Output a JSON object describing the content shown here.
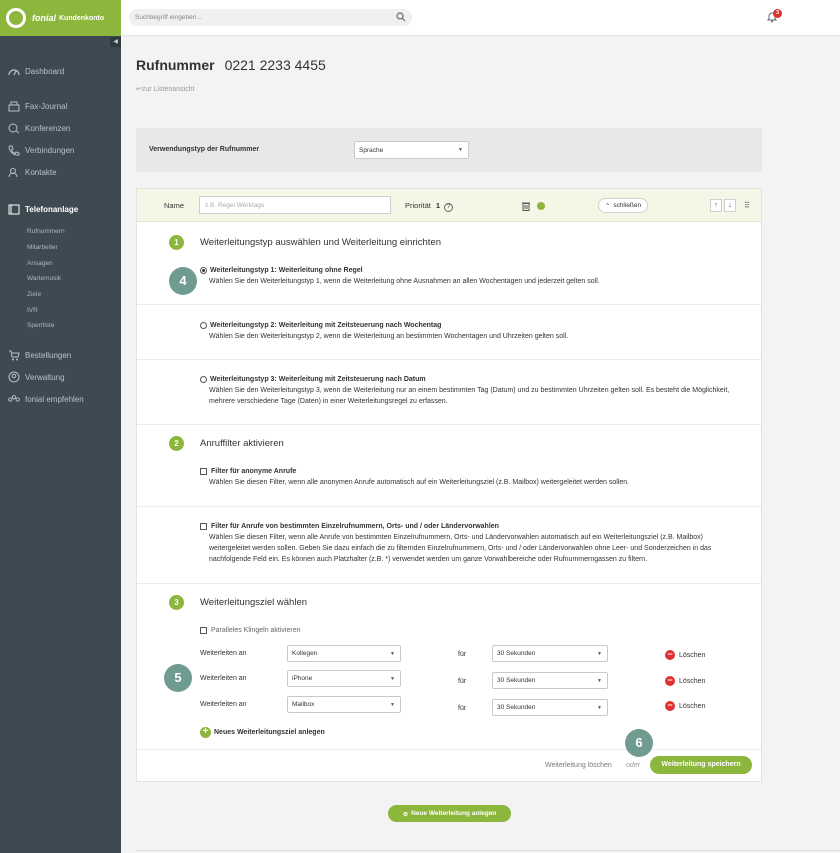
{
  "app": {
    "brand": "fonial",
    "brand_sub": "Kundenkonto"
  },
  "search": {
    "placeholder": "Suchbegriff eingeben..."
  },
  "notifications": {
    "count": "3"
  },
  "sidebar": {
    "items": [
      {
        "label": "Dashboard",
        "icon": "dashboard-icon"
      },
      {
        "label": "Fax-Journal",
        "icon": "fax-icon"
      },
      {
        "label": "Konferenzen",
        "icon": "conference-icon"
      },
      {
        "label": "Verbindungen",
        "icon": "phone-icon"
      },
      {
        "label": "Kontakte",
        "icon": "contacts-icon"
      },
      {
        "label": "Telefonanlage",
        "icon": "pbx-icon"
      }
    ],
    "sub_items": [
      "Rufnummern",
      "Mitarbeiter",
      "Ansagen",
      "Wartemusik",
      "Ziele",
      "IVR",
      "Sperrliste"
    ],
    "bottom_items": [
      {
        "label": "Bestellungen",
        "icon": "cart-icon"
      },
      {
        "label": "Verwaltung",
        "icon": "user-icon"
      },
      {
        "label": "fonial empfehlen",
        "icon": "recommend-icon"
      }
    ]
  },
  "page": {
    "title_label": "Rufnummer",
    "title_number": "0221 2233 4455",
    "back_link": "zur Listenansicht"
  },
  "usage": {
    "label": "Verwendungstyp der Rufnummer",
    "value": "Sprache"
  },
  "rule": {
    "name_label": "Name",
    "name_placeholder": "z.B. Regel Werktags",
    "priority_label": "Priorität",
    "priority_value": "1",
    "close_label": "schließen"
  },
  "step1": {
    "num": "1",
    "title": "Weiterleitungstyp auswählen und Weiterleitung einrichten",
    "options": [
      {
        "title": "Weiterleitungstyp 1: Weiterleitung ohne Regel",
        "desc": "Wählen Sie den Weiterleitungstyp 1, wenn die Weiterleitung ohne Ausnahmen an allen Wochentagen und jederzeit gelten soll.",
        "selected": true
      },
      {
        "title": "Weiterleitungstyp 2: Weiterleitung mit Zeitsteuerung nach Wochentag",
        "desc": "Wählen Sie den Weiterleitungstyp 2, wenn die Weiterleitung an bestimmten Wochentagen und Uhrzeiten gelten soll.",
        "selected": false
      },
      {
        "title": "Weiterleitungstyp 3: Weiterleitung mit Zeitsteuerung nach Datum",
        "desc": "Wählen Sie den Weiterleitungstyp 3, wenn die Weiterleitung nur an einem bestimmten Tag (Datum) und zu bestimmten Uhrzeiten gelten soll. Es besteht die Möglichkeit, mehrere verschiedene Tage (Daten) in einer Weiterleitungsregel zu erfassen.",
        "selected": false
      }
    ]
  },
  "step2": {
    "num": "2",
    "title": "Anruffilter aktivieren",
    "filters": [
      {
        "title": "Filter für anonyme Anrufe",
        "desc": "Wählen Sie diesen Filter, wenn alle anonymen Anrufe automatisch auf ein Weiterleitungsziel (z.B. Mailbox) weitergeleitet werden sollen."
      },
      {
        "title": "Filter für Anrufe von bestimmten Einzelrufnummern, Orts- und / oder Ländervorwahlen",
        "desc": "Wählen Sie diesen Filter, wenn alle Anrufe von bestimmten Einzelrufnummern, Orts- und Ländervorwahlen automatisch auf ein Weiterleitungsziel (z.B. Mailbox) weitergeleitet werden sollen. Geben Sie dazu einfach die zu filternden Einzelrufnummern, Orts- und / oder Ländervorwahlen ohne Leer- und Sonderzeichen in das nachfolgende Feld ein. Es können auch Platzhalter (z.B. *) verwendet werden um ganze Vorwahlbereiche oder Rufnummerngassen zu filtern."
      }
    ]
  },
  "step3": {
    "num": "3",
    "title": "Weiterleitungsziel wählen",
    "parallel_label": "Paralleles Klingeln aktivieren",
    "rows": [
      {
        "label": "Weiterleiten an",
        "target": "Kollegen",
        "for_label": "für",
        "duration": "30 Sekunden",
        "delete": "Löschen"
      },
      {
        "label": "Weiterleiten an",
        "target": "iPhone",
        "for_label": "für",
        "duration": "30 Sekunden",
        "delete": "Löschen"
      },
      {
        "label": "Weiterleiten an",
        "target": "Mailbox",
        "for_label": "für",
        "duration": "30 Sekunden",
        "delete": "Löschen"
      }
    ],
    "add_label": "Neues Weiterleitungsziel anlegen"
  },
  "footer": {
    "delete_label": "Weiterleitung löschen",
    "or_label": "oder",
    "save_label": "Weiterleitung speichern"
  },
  "new_forwarding": {
    "label": "Neue Weiterleitung anlegen"
  },
  "callouts": [
    "4",
    "5",
    "6"
  ],
  "colors": {
    "brand_green": "#8cb63c",
    "sidebar": "#3d4a52",
    "callout": "#6f9b91",
    "danger": "#e03131"
  }
}
